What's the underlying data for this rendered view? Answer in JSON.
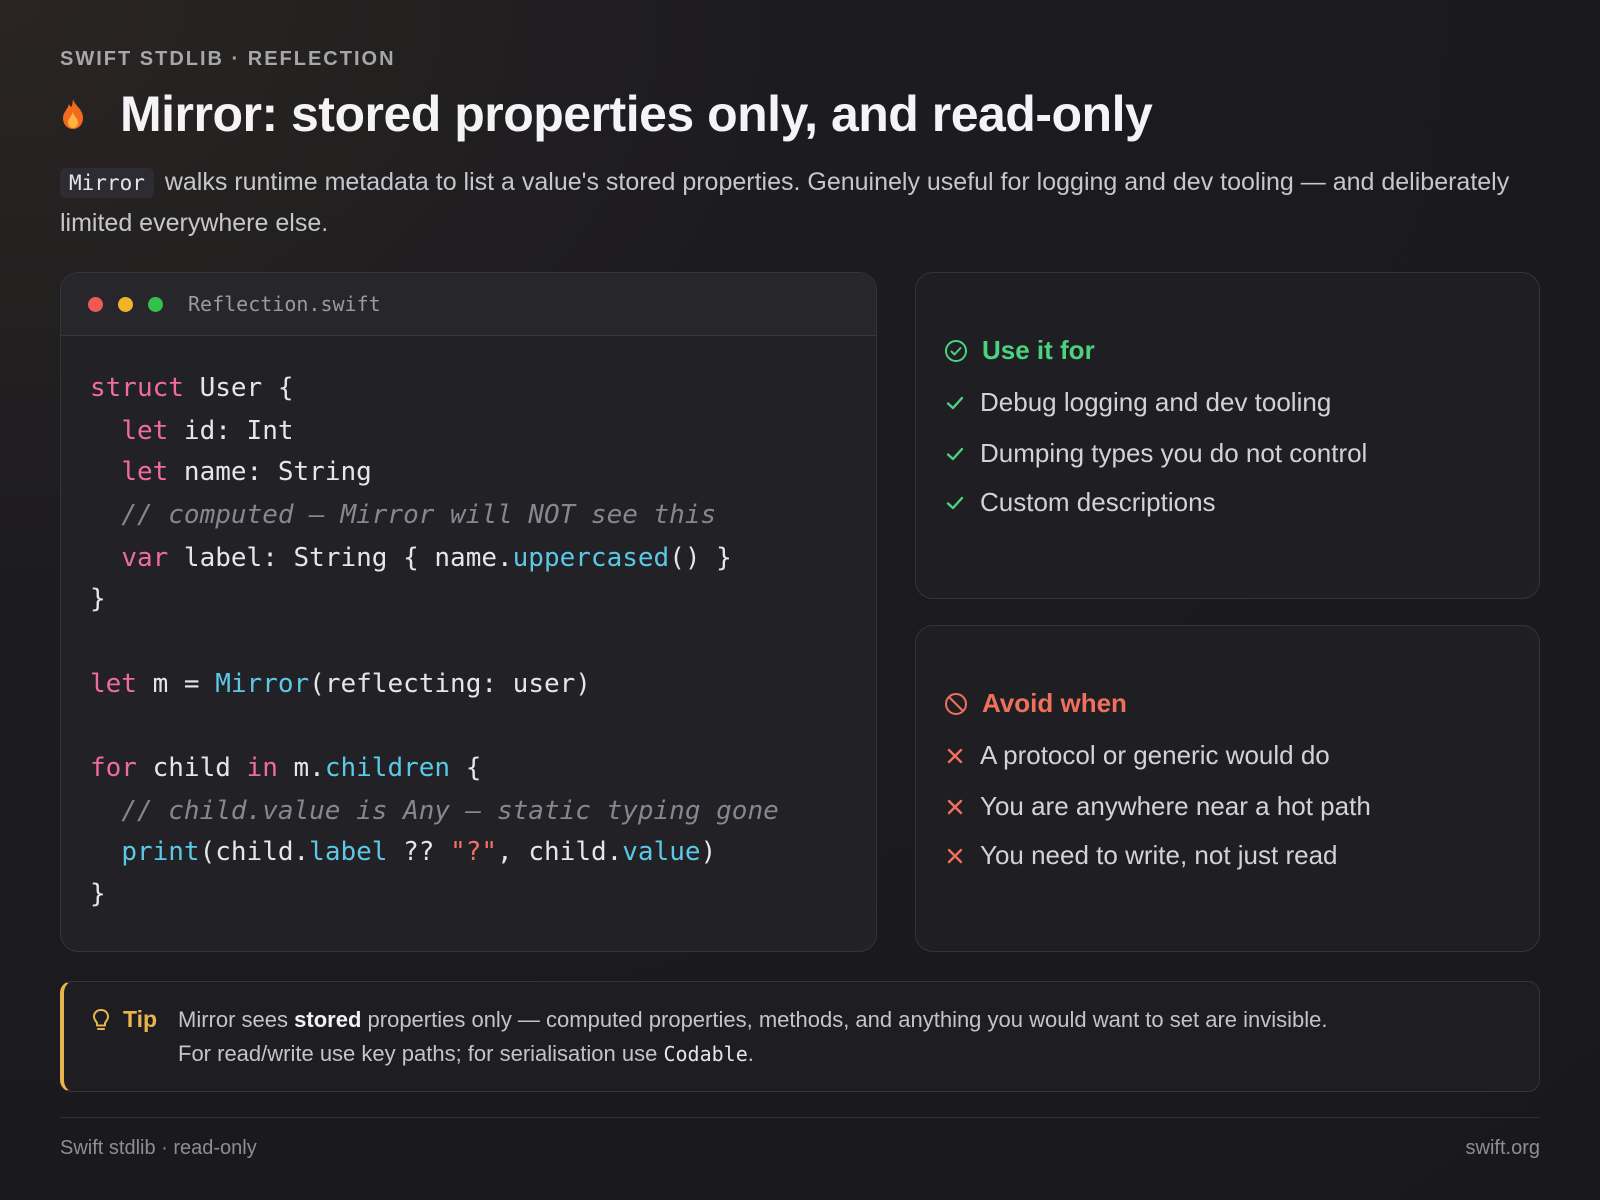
{
  "header": {
    "eyebrow": "SWIFT STDLIB · REFLECTION",
    "title": "Mirror: stored properties only, and read-only",
    "lead_code": "Mirror",
    "lead_text": "walks runtime metadata to list a value's stored properties. Genuinely useful for logging and dev tooling — and deliberately limited everywhere else.",
    "icon": "flame-icon"
  },
  "code_card": {
    "filename": "Reflection.swift",
    "window_dots": [
      "#ee5a55",
      "#f0b429",
      "#32c14a"
    ],
    "lines": [
      "struct User {",
      "  let id: Int",
      "  let name: String",
      "  // computed — Mirror will NOT see this",
      "  var label: String { name.uppercased() }",
      "}",
      "",
      "let m = Mirror(reflecting: user)",
      "",
      "for child in m.children {",
      "  // child.value is Any — static typing gone",
      "  print(child.label ?? \"?\", child.value)",
      "}"
    ]
  },
  "use_card": {
    "title": "Use it for",
    "accent": "#4cd27e",
    "items": [
      "Debug logging and dev tooling",
      "Dumping types you do not control",
      "Custom descriptions"
    ]
  },
  "avoid_card": {
    "title": "Avoid when",
    "accent": "#f0705e",
    "items": [
      "A protocol or generic would do",
      "You are anywhere near a hot path",
      "You need to write, not just read"
    ]
  },
  "tip": {
    "label": "Tip",
    "text_before": "Mirror sees",
    "text_bold": "stored",
    "text_after": "properties only — computed properties, methods, and anything you would want to set are invisible.",
    "line2_before": "For read/write use key paths; for serialisation use",
    "line2_code": "Codable",
    "line2_after": ".",
    "accent": "#e8b44e"
  },
  "footer": {
    "left": "Swift stdlib · read-only",
    "right": "swift.org"
  }
}
